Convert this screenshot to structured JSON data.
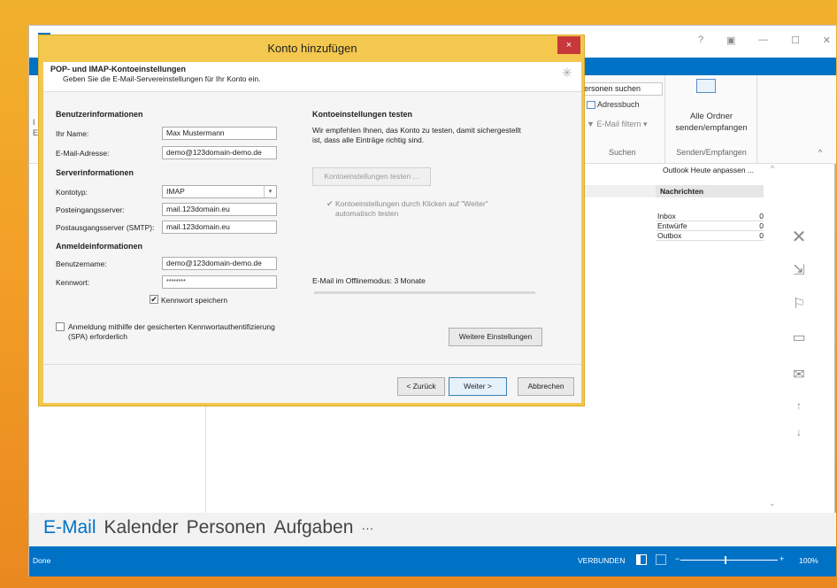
{
  "outlook": {
    "title_controls": [
      "?",
      "▣",
      "—",
      "☐",
      "✕"
    ],
    "ribbon": {
      "search_people": "ersonen suchen",
      "address_book": "Adressbuch",
      "filter_email": "E-Mail filtern",
      "group_search": "Suchen",
      "send_receive_line1": "Alle Ordner",
      "send_receive_line2": "senden/empfangen",
      "group_send_receive": "Senden/Empfangen",
      "left_letters": [
        "I",
        "E"
      ]
    },
    "customize_today": "Outlook Heute anpassen ...",
    "messages": {
      "header": "Nachrichten",
      "rows": [
        {
          "name": "Inbox",
          "count": "0"
        },
        {
          "name": "Entwürfe",
          "count": "0"
        },
        {
          "name": "Outbox",
          "count": "0"
        }
      ]
    },
    "nav": [
      "E-Mail",
      "Kalender",
      "Personen",
      "Aufgaben",
      "···"
    ],
    "status": {
      "left": "Done",
      "connection": "VERBUNDEN",
      "zoom": "100%"
    }
  },
  "dialog": {
    "title": "Konto hinzufügen",
    "close": "×",
    "header_title": "POP- und IMAP-Kontoeinstellungen",
    "header_sub": "Geben Sie die E-Mail-Servereinstellungen für Ihr Konto ein.",
    "user_info": {
      "heading": "Benutzerinformationen",
      "name_label": "Ihr Name:",
      "name_value": "Max Mustermann",
      "email_label": "E-Mail-Adresse:",
      "email_value": "demo@123domain-demo.de"
    },
    "server_info": {
      "heading": "Serverinformationen",
      "type_label": "Kontotyp:",
      "type_value": "IMAP",
      "incoming_label": "Posteingangsserver:",
      "incoming_value": "mail.123domain.eu",
      "outgoing_label": "Postausgangsserver (SMTP):",
      "outgoing_value": "mail.123domain.eu"
    },
    "login_info": {
      "heading": "Anmeldeinformationen",
      "user_label": "Benutzername:",
      "user_value": "demo@123domain-demo.de",
      "password_label": "Kennwort:",
      "password_value": "********",
      "remember_label": "Kennwort speichern"
    },
    "spa_line1": "Anmeldung mithilfe der gesicherten Kennwortauthentifizierung",
    "spa_line2": "(SPA) erforderlich",
    "test": {
      "heading": "Kontoeinstellungen testen",
      "desc_line1": "Wir empfehlen Ihnen, das Konto zu testen, damit sichergestellt",
      "desc_line2": "ist, dass alle Einträge richtig sind.",
      "test_button": "Kontoeinstellungen testen ...",
      "auto_line1": "Kontoeinstellungen durch Klicken auf \"Weiter\"",
      "auto_line2": "automatisch testen"
    },
    "offline_label": "E-Mail im Offlinemodus:",
    "offline_value": "3 Monate",
    "more_settings": "Weitere Einstellungen",
    "back": "< Zurück",
    "next": "Weiter >",
    "cancel": "Abbrechen"
  }
}
